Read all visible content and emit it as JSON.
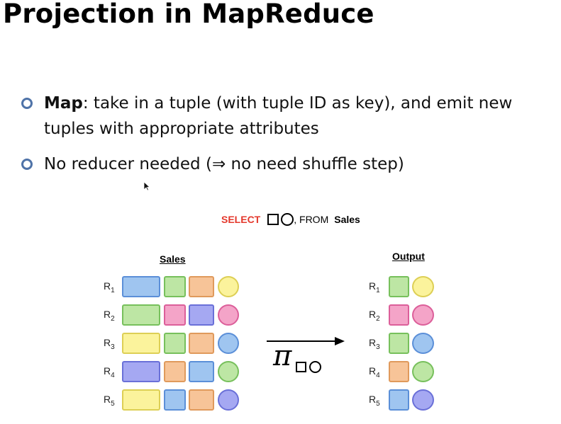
{
  "slide": {
    "title": "Projection in MapReduce",
    "bullets": [
      {
        "keyword": "Map",
        "text": ": take in a tuple (with tuple ID as key), and emit new tuples with appropriate attributes"
      },
      {
        "keyword": "",
        "text": "No reducer needed (⇒ no need shuffle step)"
      }
    ]
  },
  "figure": {
    "select_keyword": "SELECT",
    "select_rest": ", FROM",
    "select_table": "Sales",
    "input_table_title": "Sales",
    "output_table_title": "Output",
    "operator_symbol": "π",
    "row_labels": [
      {
        "prefix": "R",
        "index": "1"
      },
      {
        "prefix": "R",
        "index": "2"
      },
      {
        "prefix": "R",
        "index": "3"
      },
      {
        "prefix": "R",
        "index": "4"
      },
      {
        "prefix": "R",
        "index": "5"
      }
    ],
    "colors": {
      "blue": [
        "#9fc5f0",
        "#5b8fd8"
      ],
      "green": [
        "#bde6a4",
        "#77c05c"
      ],
      "orange": [
        "#f7c498",
        "#e09a5c"
      ],
      "yellow": [
        "#fbf39c",
        "#ddcf55"
      ],
      "pink": [
        "#f4a4c8",
        "#dc5f9a"
      ],
      "purple": [
        "#a5a8f2",
        "#6a70d8"
      ]
    },
    "sales_rows": [
      [
        "blue",
        "green",
        "orange",
        "yellow"
      ],
      [
        "green",
        "pink",
        "purple",
        "pink"
      ],
      [
        "yellow",
        "green",
        "orange",
        "blue"
      ],
      [
        "purple",
        "orange",
        "blue",
        "green"
      ],
      [
        "yellow",
        "blue",
        "orange",
        "purple"
      ]
    ],
    "output_rows": [
      [
        "green",
        "yellow"
      ],
      [
        "pink",
        "pink"
      ],
      [
        "green",
        "blue"
      ],
      [
        "orange",
        "green"
      ],
      [
        "blue",
        "purple"
      ]
    ]
  }
}
